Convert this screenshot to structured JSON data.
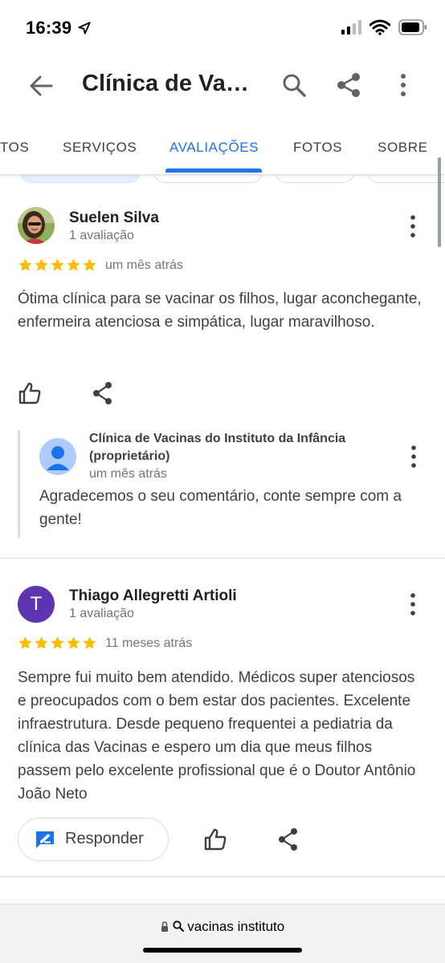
{
  "status_bar": {
    "time": "16:39"
  },
  "app_bar": {
    "title": "Clínica de Vaci..."
  },
  "tabs": [
    {
      "label": "TOS",
      "active": false
    },
    {
      "label": "SERVIÇOS",
      "active": false
    },
    {
      "label": "AVALIAÇÕES",
      "active": true
    },
    {
      "label": "FOTOS",
      "active": false
    },
    {
      "label": "SOBRE",
      "active": false
    }
  ],
  "reviews": [
    {
      "name": "Suelen Silva",
      "meta": "1 avaliação",
      "rating": 5,
      "date": "um mês atrás",
      "text": "Ótima clínica para se vacinar os filhos, lugar aconchegante, enfermeira atenciosa e simpática, lugar maravilhoso.",
      "owner_reply": {
        "name": "Clínica de Vacinas do Instituto da Infância (proprietário)",
        "date": "um mês atrás",
        "text": "Agradecemos o seu comentário, conte sempre com a gente!"
      }
    },
    {
      "name": "Thiago Allegretti Artioli",
      "avatar_letter": "T",
      "meta": "1 avaliação",
      "rating": 5,
      "date": "11 meses atrás",
      "text": "Sempre fui muito bem atendido. Médicos super atenciosos e preocupados com o bem estar dos pacientes. Excelente infraestrutura. Desde pequeno frequentei a pediatria da clínica das Vacinas e espero um dia que meus filhos passem pelo excelente profissional que é o Doutor Antônio João Neto",
      "reply_button_label": "Responder"
    }
  ],
  "url_bar": {
    "text": "vacinas instituto"
  },
  "colors": {
    "accent": "#1a73e8",
    "star": "#fbbc04",
    "avatar_purple": "#5e35b1"
  }
}
